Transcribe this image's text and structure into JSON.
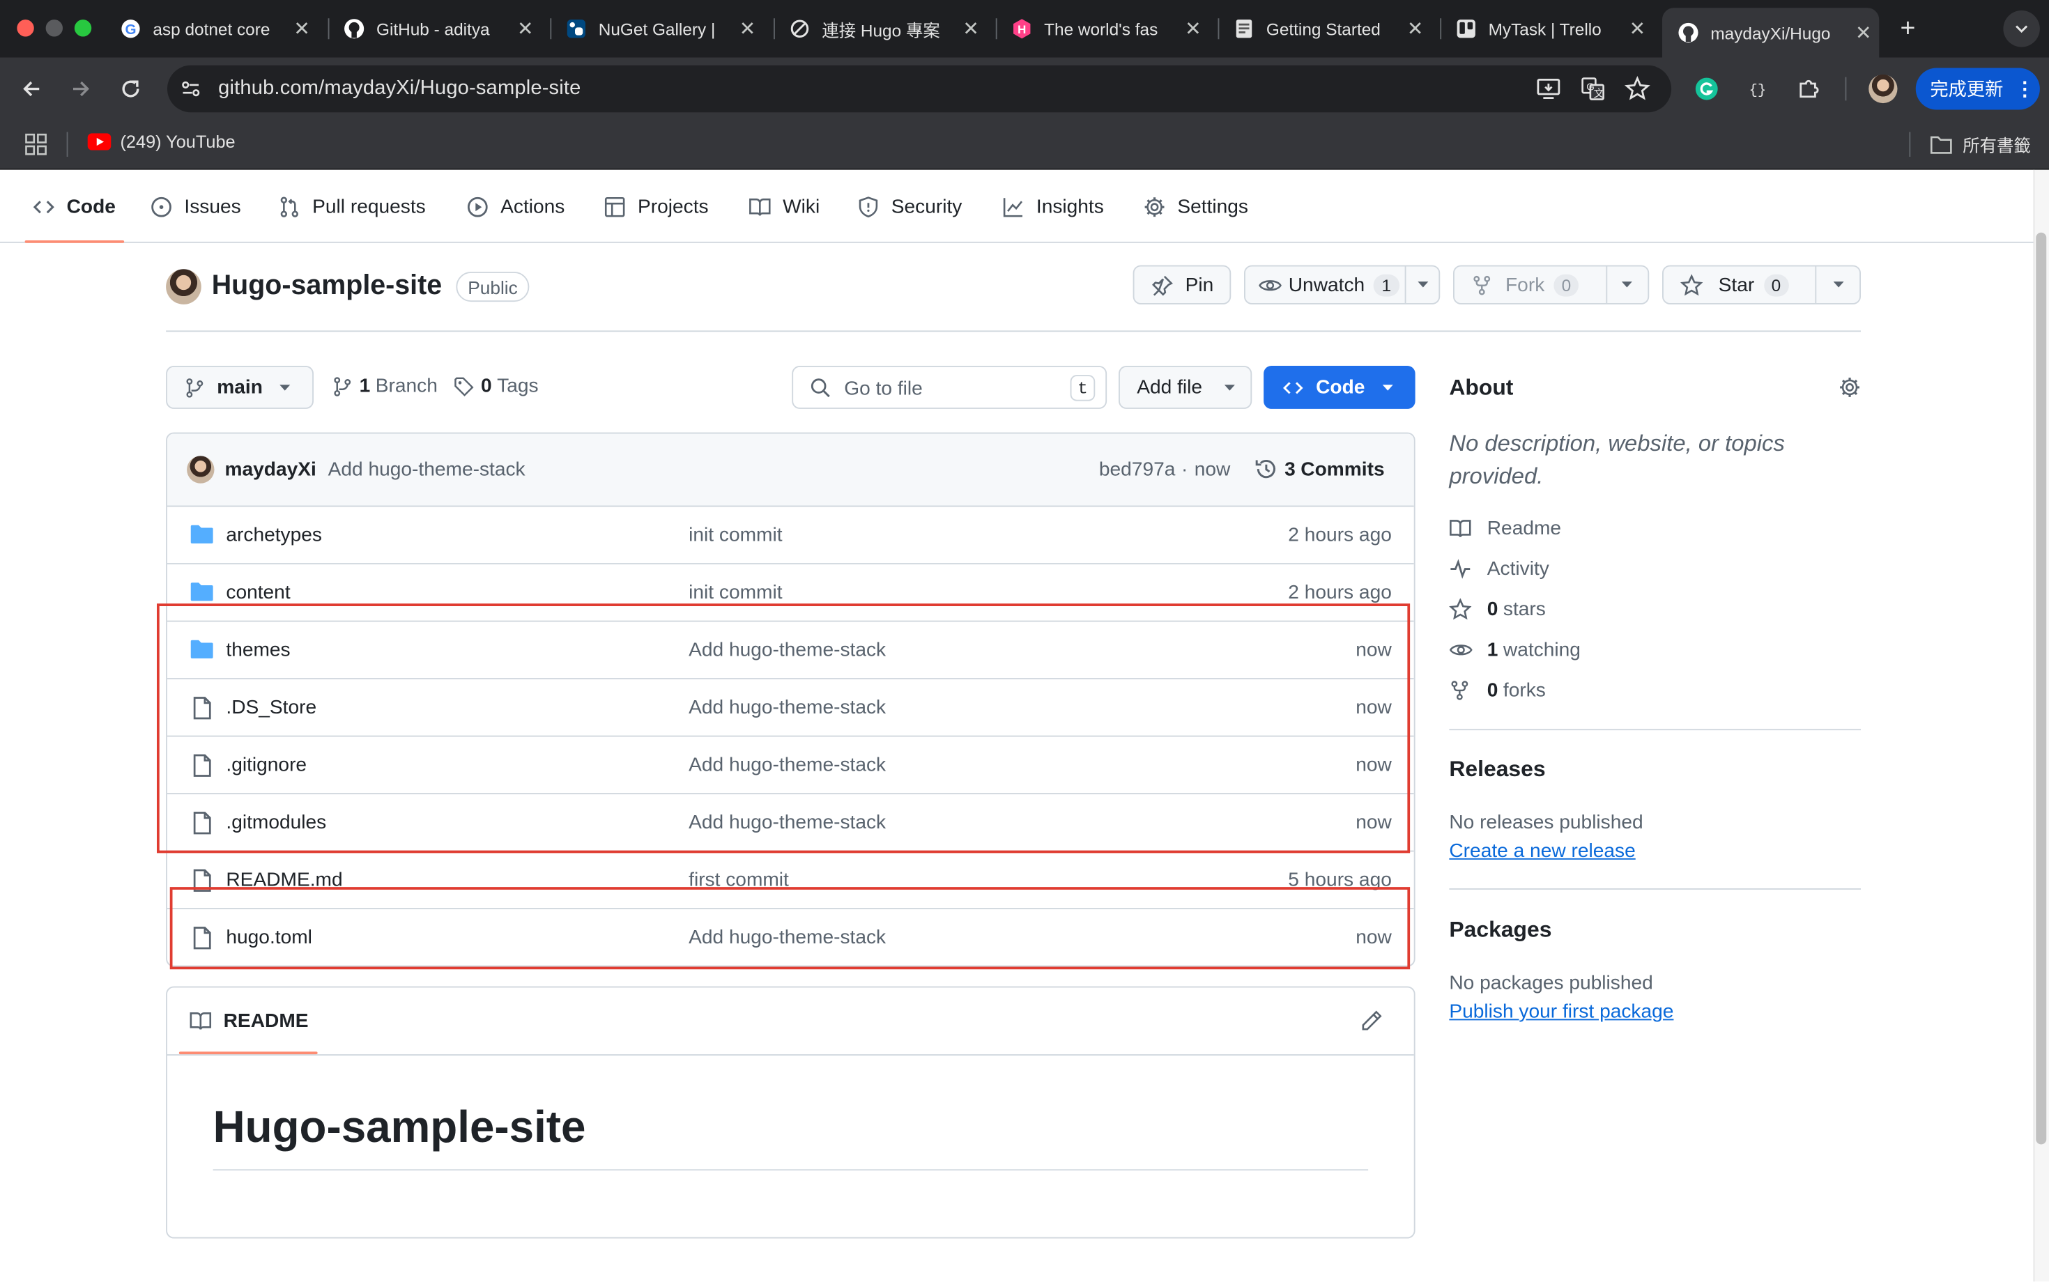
{
  "browser": {
    "tabs": [
      {
        "title": "asp dotnet core",
        "icon": "google-icon"
      },
      {
        "title": "GitHub - aditya",
        "icon": "github-icon"
      },
      {
        "title": "NuGet Gallery |",
        "icon": "nuget-icon"
      },
      {
        "title": "連接 Hugo 專案",
        "icon": "hugo-sync-icon"
      },
      {
        "title": "The world's fas",
        "icon": "hugo-logo-icon"
      },
      {
        "title": "Getting Started",
        "icon": "doc-icon"
      },
      {
        "title": "MyTask | Trello",
        "icon": "trello-icon"
      },
      {
        "title": "maydayXi/Hugo",
        "icon": "github-icon",
        "active": true
      }
    ],
    "url": "github.com/maydayXi/Hugo-sample-site",
    "update_button": "完成更新",
    "bookmarks": [
      {
        "label": "(249) YouTube",
        "icon": "youtube-icon"
      }
    ],
    "all_bookmarks": "所有書籤"
  },
  "repo_nav": [
    {
      "label": "Code",
      "icon": "code-icon",
      "selected": true
    },
    {
      "label": "Issues",
      "icon": "issue-icon"
    },
    {
      "label": "Pull requests",
      "icon": "pull-request-icon"
    },
    {
      "label": "Actions",
      "icon": "play-icon"
    },
    {
      "label": "Projects",
      "icon": "table-icon"
    },
    {
      "label": "Wiki",
      "icon": "book-icon"
    },
    {
      "label": "Security",
      "icon": "shield-icon"
    },
    {
      "label": "Insights",
      "icon": "graph-icon"
    },
    {
      "label": "Settings",
      "icon": "gear-icon"
    }
  ],
  "repo": {
    "name": "Hugo-sample-site",
    "visibility": "Public",
    "pin_label": "Pin",
    "watch_label": "Unwatch",
    "watch_count": "1",
    "fork_label": "Fork",
    "fork_count": "0",
    "star_label": "Star",
    "star_count": "0"
  },
  "branch_bar": {
    "branch": "main",
    "branches_count": "1",
    "branches_label": "Branch",
    "tags_count": "0",
    "tags_label": "Tags",
    "goto_placeholder": "Go to file",
    "goto_key": "t",
    "add_file": "Add file",
    "code_button": "Code"
  },
  "latest_commit": {
    "author": "maydayXi",
    "message": "Add hugo-theme-stack",
    "hash": "bed797a",
    "time": "now",
    "commits_count": "3",
    "commits_label": "Commits"
  },
  "files": [
    {
      "name": "archetypes",
      "type": "dir",
      "message": "init commit",
      "date": "2 hours ago"
    },
    {
      "name": "content",
      "type": "dir",
      "message": "init commit",
      "date": "2 hours ago"
    },
    {
      "name": "themes",
      "type": "dir",
      "message": "Add hugo-theme-stack",
      "date": "now"
    },
    {
      "name": ".DS_Store",
      "type": "file",
      "message": "Add hugo-theme-stack",
      "date": "now"
    },
    {
      "name": ".gitignore",
      "type": "file",
      "message": "Add hugo-theme-stack",
      "date": "now"
    },
    {
      "name": ".gitmodules",
      "type": "file",
      "message": "Add hugo-theme-stack",
      "date": "now"
    },
    {
      "name": "README.md",
      "type": "file",
      "message": "first commit",
      "date": "5 hours ago"
    },
    {
      "name": "hugo.toml",
      "type": "file",
      "message": "Add hugo-theme-stack",
      "date": "now"
    }
  ],
  "readme": {
    "tab_label": "README",
    "heading": "Hugo-sample-site"
  },
  "about": {
    "title": "About",
    "description": "No description, website, or topics provided.",
    "readme_link": "Readme",
    "activity_link": "Activity",
    "stars_count": "0",
    "stars_label": "stars",
    "watching_count": "1",
    "watching_label": "watching",
    "forks_count": "0",
    "forks_label": "forks"
  },
  "releases": {
    "title": "Releases",
    "text": "No releases published",
    "link": "Create a new release"
  },
  "packages": {
    "title": "Packages",
    "text": "No packages published",
    "link": "Publish your first package"
  },
  "colors": {
    "annotation": "#e03c31",
    "primary_button": "#1f6feb",
    "folder": "#54aeff",
    "accent_underline": "#fd8c73",
    "link": "#0969da"
  }
}
